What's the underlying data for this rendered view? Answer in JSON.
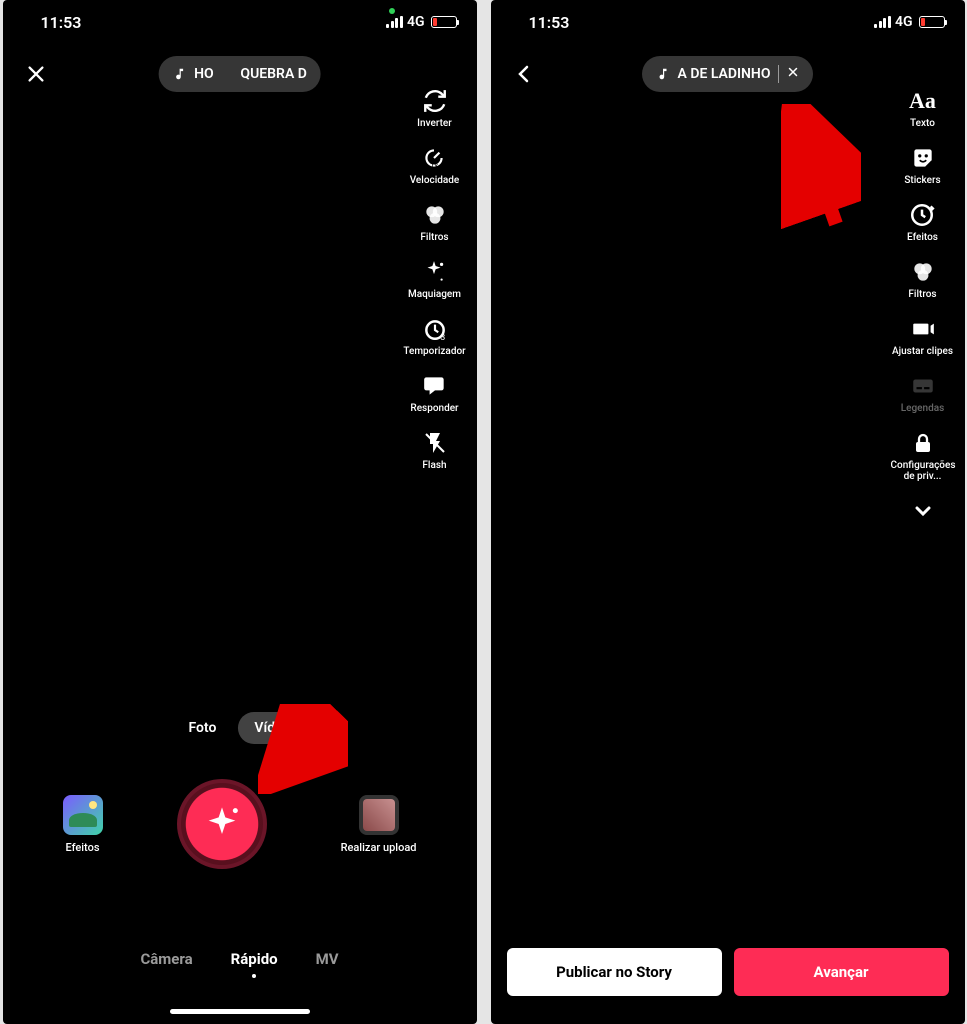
{
  "status": {
    "time": "11:53",
    "network": "4G"
  },
  "left": {
    "sound_text_a": "HO",
    "sound_text_b": "QUEBRA D",
    "tools": {
      "inverter": "Inverter",
      "velocidade": "Velocidade",
      "filtros": "Filtros",
      "maquiagem": "Maquiagem",
      "temporizador": "Temporizador",
      "responder": "Responder",
      "flash": "Flash"
    },
    "capture_tabs": {
      "foto": "Foto",
      "video": "Vídeo"
    },
    "side_actions": {
      "efeitos": "Efeitos",
      "upload": "Realizar upload"
    },
    "modes": {
      "camera": "Câmera",
      "rapido": "Rápido",
      "mv": "MV"
    }
  },
  "right": {
    "sound_text": "A DE LADINHO",
    "tools": {
      "texto": "Texto",
      "stickers": "Stickers",
      "efeitos": "Efeitos",
      "filtros": "Filtros",
      "ajustar": "Ajustar clipes",
      "legendas": "Legendas",
      "privacidade": "Configurações de priv..."
    },
    "buttons": {
      "story": "Publicar no Story",
      "next": "Avançar"
    }
  },
  "colors": {
    "accent": "#fe2c55"
  }
}
